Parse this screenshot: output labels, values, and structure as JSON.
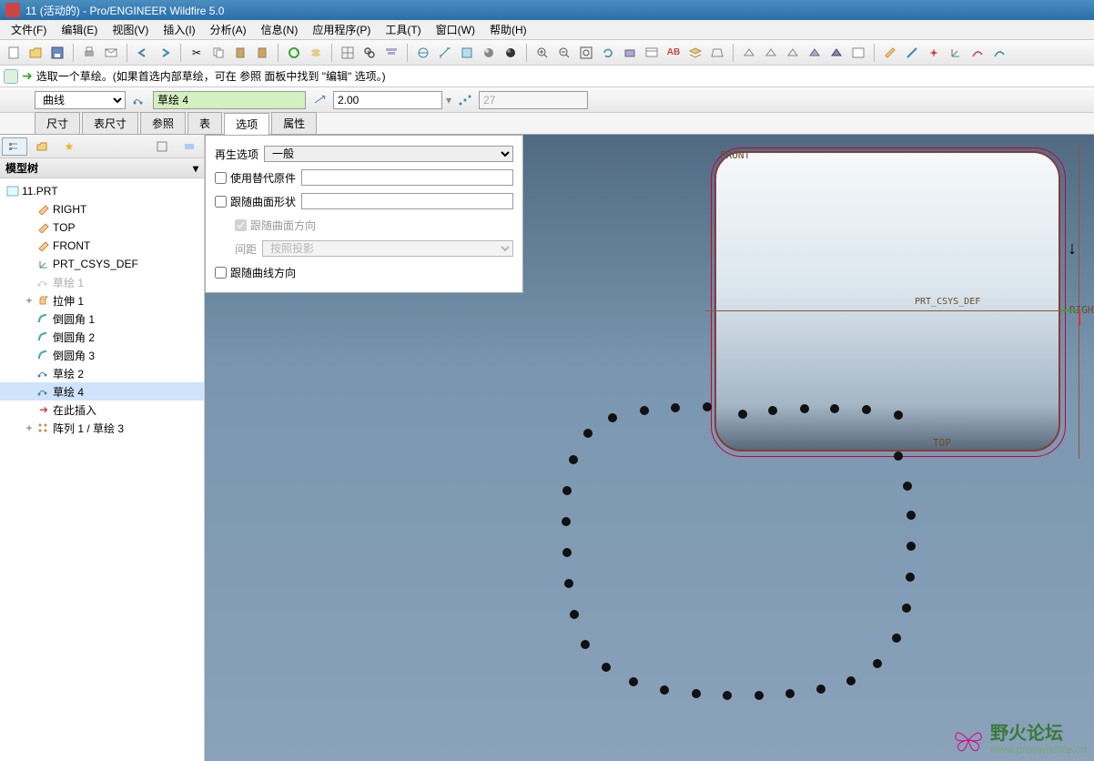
{
  "title": "11 (活动的) - Pro/ENGINEER Wildfire 5.0",
  "menu": [
    "文件(F)",
    "编辑(E)",
    "视图(V)",
    "插入(I)",
    "分析(A)",
    "信息(N)",
    "应用程序(P)",
    "工具(T)",
    "窗口(W)",
    "帮助(H)"
  ],
  "info_message": "选取一个草绘。(如果首选内部草绘，可在 参照 面板中找到 \"编辑\" 选项。)",
  "dashboard": {
    "type_select": "曲线",
    "sketch_label": "草绘 4",
    "value": "2.00",
    "count": "27"
  },
  "tabs": [
    "尺寸",
    "表尺寸",
    "参照",
    "表",
    "选项",
    "属性"
  ],
  "active_tab": "选项",
  "options_panel": {
    "regen_label": "再生选项",
    "regen_value": "一般",
    "use_sub_label": "使用替代原件",
    "follow_surface_label": "跟随曲面形状",
    "follow_surface_dir_label": "跟随曲面方向",
    "spacing_label": "间距",
    "spacing_value": "按照投影",
    "follow_curve_label": "跟随曲线方向"
  },
  "sidebar": {
    "header": "模型树",
    "root": "11.PRT",
    "items": [
      {
        "icon": "plane",
        "label": "RIGHT",
        "indent": 1
      },
      {
        "icon": "plane",
        "label": "TOP",
        "indent": 1
      },
      {
        "icon": "plane",
        "label": "FRONT",
        "indent": 1
      },
      {
        "icon": "csys",
        "label": "PRT_CSYS_DEF",
        "indent": 1
      },
      {
        "icon": "sketch-dim",
        "label": "草绘 1",
        "indent": 1
      },
      {
        "icon": "extrude",
        "label": "拉伸 1",
        "indent": 1,
        "exp": "+"
      },
      {
        "icon": "round",
        "label": "倒圆角 1",
        "indent": 1
      },
      {
        "icon": "round",
        "label": "倒圆角 2",
        "indent": 1
      },
      {
        "icon": "round",
        "label": "倒圆角 3",
        "indent": 1
      },
      {
        "icon": "sketch",
        "label": "草绘 2",
        "indent": 1
      },
      {
        "icon": "sketch",
        "label": "草绘 4",
        "indent": 1,
        "selected": true
      },
      {
        "icon": "insert",
        "label": "在此插入",
        "indent": 1
      },
      {
        "icon": "pattern",
        "label": "阵列 1 / 草绘 3",
        "indent": 1,
        "exp": "+"
      }
    ]
  },
  "datums": {
    "front": "FRONT",
    "right": "RIGHT",
    "top": "TOP",
    "csys": "PRT_CSYS_DEF"
  },
  "watermark": {
    "text": "野火论坛",
    "url": "www.proewildfire.cn"
  }
}
